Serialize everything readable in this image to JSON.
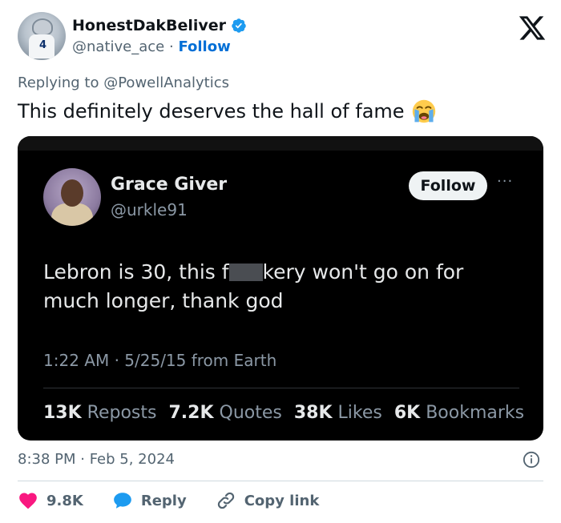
{
  "author": {
    "display_name": "HonestDakBeliver",
    "handle": "@native_ace",
    "separator": "·",
    "follow_label": "Follow",
    "avatar_number": "4"
  },
  "reply": {
    "prefix": "Replying to",
    "mention": "@PowellAnalytics"
  },
  "tweet": {
    "text": "This definitely deserves the hall of fame",
    "emoji": "loudly-crying-face"
  },
  "embedded": {
    "display_name": "Grace Giver",
    "handle": "@urkle91",
    "follow_label": "Follow",
    "more": "···",
    "text_before": "Lebron is 30, this f",
    "text_after": "kery won't go on for much longer, thank god",
    "timestamp": "1:22 AM · 5/25/15 from Earth",
    "stats": {
      "reposts_count": "13K",
      "reposts_label": "Reposts",
      "quotes_count": "7.2K",
      "quotes_label": "Quotes",
      "likes_count": "38K",
      "likes_label": "Likes",
      "bookmarks_count": "6K",
      "bookmarks_label": "Bookmarks"
    }
  },
  "meta": {
    "timestamp": "8:38 PM · Feb 5, 2024"
  },
  "actions": {
    "likes": "9.8K",
    "reply_label": "Reply",
    "copy_label": "Copy link"
  },
  "colors": {
    "accent": "#1d9bf0",
    "heart": "#f91880",
    "link": "#006fd6"
  }
}
